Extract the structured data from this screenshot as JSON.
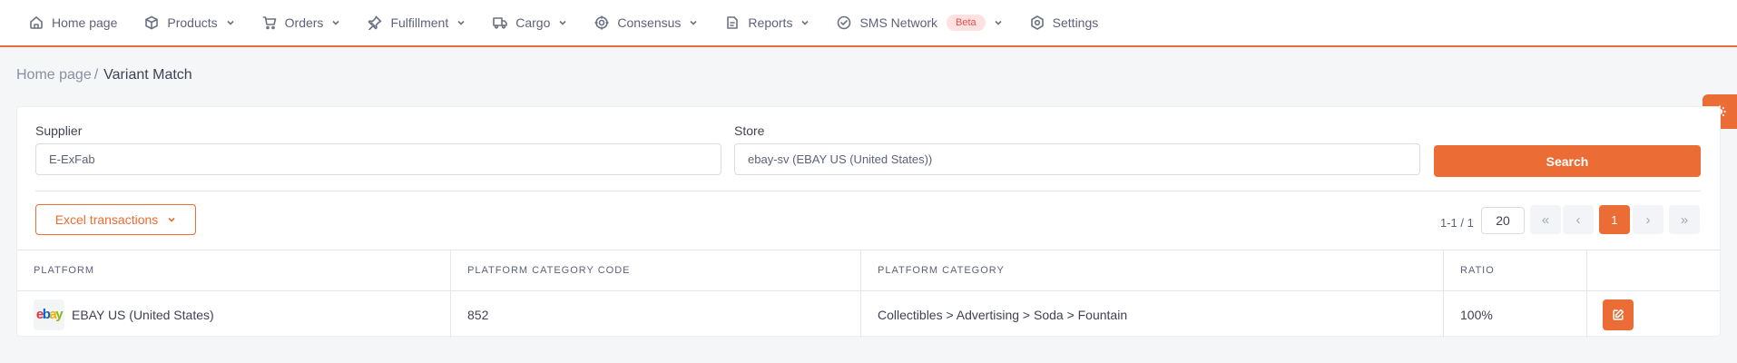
{
  "nav": {
    "items": [
      {
        "label": "Home page",
        "icon": "home-icon",
        "dropdown": false
      },
      {
        "label": "Products",
        "icon": "box-icon",
        "dropdown": true
      },
      {
        "label": "Orders",
        "icon": "cart-icon",
        "dropdown": true
      },
      {
        "label": "Fulfillment",
        "icon": "pin-icon",
        "dropdown": true
      },
      {
        "label": "Cargo",
        "icon": "truck-icon",
        "dropdown": true
      },
      {
        "label": "Consensus",
        "icon": "target-icon",
        "dropdown": true
      },
      {
        "label": "Reports",
        "icon": "report-icon",
        "dropdown": true
      },
      {
        "label": "SMS Network",
        "icon": "check-circle-icon",
        "dropdown": true,
        "badge": "Beta"
      },
      {
        "label": "Settings",
        "icon": "gear-icon",
        "dropdown": false
      }
    ]
  },
  "breadcrumb": {
    "home": "Home page",
    "separator": "/",
    "current": "Variant Match"
  },
  "filters": {
    "supplier_label": "Supplier",
    "supplier_value": "E-ExFab",
    "store_label": "Store",
    "store_value": "ebay-sv (EBAY US (United States))",
    "search_label": "Search"
  },
  "toolbar": {
    "excel_label": "Excel transactions"
  },
  "pagination": {
    "info": "1-1 / 1",
    "page_size": "20",
    "current_page": "1",
    "first": "«",
    "prev": "‹",
    "next": "›",
    "last": "»"
  },
  "table": {
    "columns": [
      "PLATFORM",
      "PLATFORM CATEGORY CODE",
      "PLATFORM CATEGORY",
      "RATIO",
      ""
    ],
    "rows": [
      {
        "platform": "EBAY US (United States)",
        "code": "852",
        "category": "Collectibles > Advertising > Soda > Fountain",
        "ratio": "100%"
      }
    ]
  },
  "colors": {
    "accent": "#ec6c35",
    "badge_bg": "#fde2e1",
    "badge_text": "#e84d4d"
  }
}
